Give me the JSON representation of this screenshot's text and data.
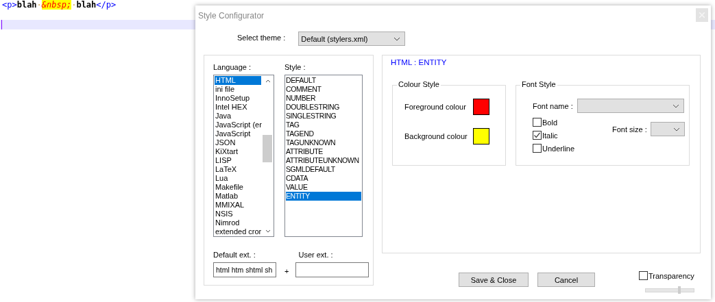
{
  "editor": {
    "lines": [
      {
        "current": false,
        "segments": [
          {
            "text": "<p>",
            "kind": "tag"
          },
          {
            "text": "blah",
            "kind": "text"
          },
          {
            "text": "·",
            "kind": "space"
          },
          {
            "text": "&nbsp;",
            "kind": "entity"
          },
          {
            "text": "·",
            "kind": "space"
          },
          {
            "text": "blah",
            "kind": "text"
          },
          {
            "text": "</p>",
            "kind": "tag"
          }
        ]
      },
      {
        "current": true
      }
    ]
  },
  "dialog": {
    "title": "Style Configurator",
    "theme": {
      "label": "Select theme :",
      "value": "Default (stylers.xml)"
    },
    "language": {
      "label": "Language :",
      "items": [
        {
          "text": "HTML",
          "selected": true
        },
        {
          "text": "ini file",
          "selected": false
        },
        {
          "text": "InnoSetup",
          "selected": false
        },
        {
          "text": "Intel HEX",
          "selected": false
        },
        {
          "text": "Java",
          "selected": false
        },
        {
          "text": "JavaScript (er",
          "selected": false
        },
        {
          "text": "JavaScript",
          "selected": false
        },
        {
          "text": "JSON",
          "selected": false
        },
        {
          "text": "KiXtart",
          "selected": false
        },
        {
          "text": "LISP",
          "selected": false
        },
        {
          "text": "LaTeX",
          "selected": false
        },
        {
          "text": "Lua",
          "selected": false
        },
        {
          "text": "Makefile",
          "selected": false
        },
        {
          "text": "Matlab",
          "selected": false
        },
        {
          "text": "MMIXAL",
          "selected": false
        },
        {
          "text": "NSIS",
          "selected": false
        },
        {
          "text": "Nimrod",
          "selected": false
        },
        {
          "text": "extended cror",
          "selected": false
        }
      ]
    },
    "style": {
      "label": "Style :",
      "items": [
        {
          "text": "DEFAULT",
          "selected": false
        },
        {
          "text": "COMMENT",
          "selected": false
        },
        {
          "text": "NUMBER",
          "selected": false
        },
        {
          "text": "DOUBLESTRING",
          "selected": false
        },
        {
          "text": "SINGLESTRING",
          "selected": false
        },
        {
          "text": "TAG",
          "selected": false
        },
        {
          "text": "TAGEND",
          "selected": false
        },
        {
          "text": "TAGUNKNOWN",
          "selected": false
        },
        {
          "text": "ATTRIBUTE",
          "selected": false
        },
        {
          "text": "ATTRIBUTEUNKNOWN",
          "selected": false
        },
        {
          "text": "SGMLDEFAULT",
          "selected": false
        },
        {
          "text": "CDATA",
          "selected": false
        },
        {
          "text": "VALUE",
          "selected": false
        },
        {
          "text": "ENTITY",
          "selected": true
        }
      ]
    },
    "default_ext": {
      "label": "Default ext. :",
      "value": "html htm shtml sh"
    },
    "plus": "+",
    "user_ext": {
      "label": "User ext. :"
    },
    "heading": "HTML : ENTITY",
    "colour_style": {
      "title": "Colour Style",
      "foreground": {
        "label": "Foreground colour",
        "color": "#ff0000"
      },
      "background": {
        "label": "Background colour",
        "color": "#ffff00"
      }
    },
    "font_style": {
      "title": "Font Style",
      "font_name_label": "Font name :",
      "font_size_label": "Font size :",
      "options": [
        {
          "label": "Bold",
          "checked": false
        },
        {
          "label": "Italic",
          "checked": true
        },
        {
          "label": "Underline",
          "checked": false
        }
      ]
    },
    "buttons": [
      "Save & Close",
      "Cancel"
    ],
    "transparency": {
      "label": "Transparency",
      "checked": false,
      "level": 0.7
    }
  }
}
